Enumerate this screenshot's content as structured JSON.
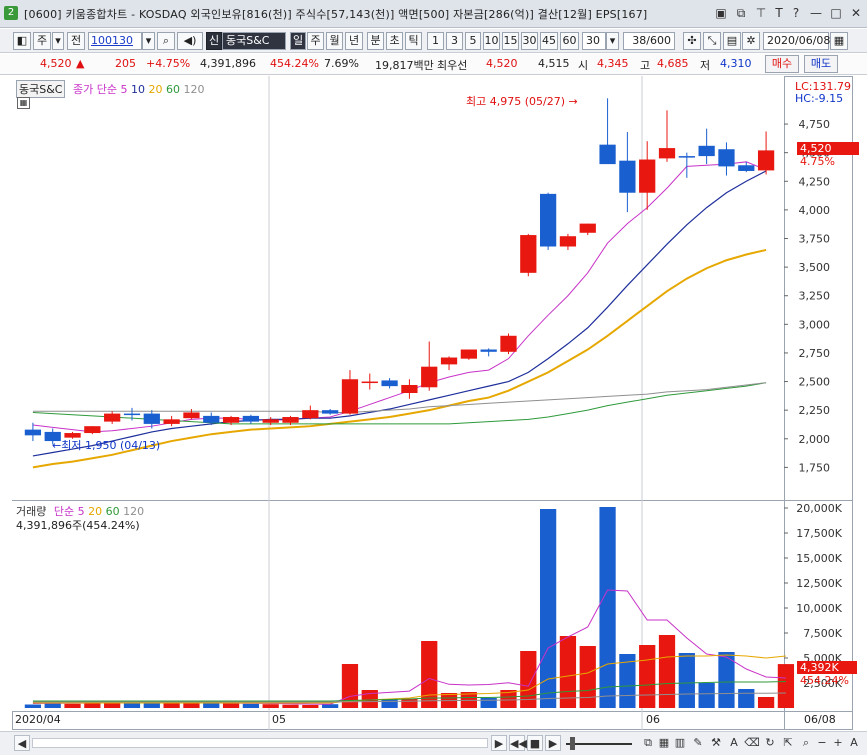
{
  "window": {
    "title": "[0600] 키움종합차트 - KOSDAQ 외국인보유[816(천)] 주식수[57,143(천)] 액면[500] 자본금[286(억)] 결산[12월] EPS[167]",
    "screen_number": "2"
  },
  "toolbar": {
    "mode_label": "주",
    "prev_label": "전",
    "stock_code": "100130",
    "stock_badge": "신",
    "stock_name": "동국S&C",
    "periods": [
      "일",
      "주",
      "월",
      "년",
      "분",
      "초",
      "틱"
    ],
    "intervals": [
      "1",
      "3",
      "5",
      "10",
      "15",
      "30",
      "45",
      "60"
    ],
    "interval_value": "30",
    "count_value": "38/600",
    "date_value": "2020/06/08"
  },
  "quote": {
    "price": "4,520",
    "arrow": "▲",
    "change": "205",
    "change_pct": "+4.75%",
    "volume": "4,391,896",
    "volume_ratio": "454.24%",
    "turnover": "7.69%",
    "amount": "19,817백만",
    "priority_label": "최우선",
    "ask1": "4,520",
    "bid1": "4,515",
    "open_label": "시",
    "open": "4,345",
    "high_label": "고",
    "high": "4,685",
    "low_label": "저",
    "low": "4,310",
    "buy_label": "매수",
    "sell_label": "매도"
  },
  "price_legend": {
    "name": "동국S&C",
    "ma_label": "종가 단순",
    "ma_periods": [
      "5",
      "10",
      "20",
      "60",
      "120"
    ]
  },
  "volume_legend": {
    "name": "거래량",
    "ma_label": "단순",
    "ma_periods": [
      "5",
      "20",
      "60",
      "120"
    ],
    "current": "4,391,896주(454.24%)"
  },
  "side_labels": {
    "lc": "LC:131.79",
    "hc": "HC:-9.15",
    "price_tag": "4,520",
    "pct_tag": "4.75%",
    "vol_tag": "4,392K",
    "vol_pct_tag": "454.24%"
  },
  "annotations": {
    "high_text": "최고 4,975 (05/27)",
    "low_text": "최저 1,950 (04/13)"
  },
  "x_labels": [
    "2020/04",
    "05",
    "06",
    "06/08"
  ],
  "colors": {
    "up": "#e8170f",
    "down": "#1a5fd0",
    "ma5": "#c832c8",
    "ma10": "#1e2f9c",
    "ma20": "#e6a800",
    "ma60": "#2e9a3a",
    "ma120": "#8f8f8f"
  },
  "chart_data": [
    {
      "type": "candlestick",
      "title": "동국S&C",
      "ylim": [
        1500,
        5100
      ],
      "yticks": [
        "1,750",
        "2,000",
        "2,250",
        "2,500",
        "2,750",
        "3,000",
        "3,250",
        "3,500",
        "3,750",
        "4,000",
        "4,250",
        "4,500",
        "4,750"
      ],
      "candles": [
        {
          "o": 2080,
          "h": 2140,
          "l": 1980,
          "c": 2030
        },
        {
          "o": 2060,
          "h": 2090,
          "l": 1950,
          "c": 1980
        },
        {
          "o": 2010,
          "h": 2060,
          "l": 2000,
          "c": 2050
        },
        {
          "o": 2050,
          "h": 2110,
          "l": 2040,
          "c": 2110
        },
        {
          "o": 2150,
          "h": 2240,
          "l": 2130,
          "c": 2220
        },
        {
          "o": 2220,
          "h": 2270,
          "l": 2160,
          "c": 2210
        },
        {
          "o": 2220,
          "h": 2250,
          "l": 2090,
          "c": 2130
        },
        {
          "o": 2130,
          "h": 2200,
          "l": 2110,
          "c": 2170
        },
        {
          "o": 2180,
          "h": 2260,
          "l": 2170,
          "c": 2230
        },
        {
          "o": 2200,
          "h": 2230,
          "l": 2120,
          "c": 2140
        },
        {
          "o": 2140,
          "h": 2200,
          "l": 2120,
          "c": 2190
        },
        {
          "o": 2200,
          "h": 2210,
          "l": 2130,
          "c": 2150
        },
        {
          "o": 2140,
          "h": 2190,
          "l": 2120,
          "c": 2170
        },
        {
          "o": 2140,
          "h": 2200,
          "l": 2120,
          "c": 2190
        },
        {
          "o": 2180,
          "h": 2290,
          "l": 2170,
          "c": 2250
        },
        {
          "o": 2250,
          "h": 2260,
          "l": 2210,
          "c": 2220
        },
        {
          "o": 2220,
          "h": 2600,
          "l": 2210,
          "c": 2520
        },
        {
          "o": 2500,
          "h": 2570,
          "l": 2430,
          "c": 2500
        },
        {
          "o": 2510,
          "h": 2530,
          "l": 2440,
          "c": 2460
        },
        {
          "o": 2400,
          "h": 2520,
          "l": 2350,
          "c": 2470
        },
        {
          "o": 2450,
          "h": 2850,
          "l": 2420,
          "c": 2630
        },
        {
          "o": 2650,
          "h": 2720,
          "l": 2600,
          "c": 2710
        },
        {
          "o": 2700,
          "h": 2780,
          "l": 2690,
          "c": 2780
        },
        {
          "o": 2780,
          "h": 2790,
          "l": 2720,
          "c": 2760
        },
        {
          "o": 2760,
          "h": 2920,
          "l": 2740,
          "c": 2900
        },
        {
          "o": 3450,
          "h": 3790,
          "l": 3420,
          "c": 3780
        },
        {
          "o": 4140,
          "h": 4150,
          "l": 3650,
          "c": 3680
        },
        {
          "o": 3680,
          "h": 3790,
          "l": 3650,
          "c": 3770
        },
        {
          "o": 3800,
          "h": 3880,
          "l": 3780,
          "c": 3880
        },
        {
          "o": 4570,
          "h": 4975,
          "l": 4420,
          "c": 4400
        },
        {
          "o": 4430,
          "h": 4680,
          "l": 3980,
          "c": 4150
        },
        {
          "o": 4150,
          "h": 4600,
          "l": 4000,
          "c": 4440
        },
        {
          "o": 4450,
          "h": 4870,
          "l": 4420,
          "c": 4540
        },
        {
          "o": 4470,
          "h": 4500,
          "l": 4280,
          "c": 4460
        },
        {
          "o": 4560,
          "h": 4710,
          "l": 4400,
          "c": 4470
        },
        {
          "o": 4530,
          "h": 4590,
          "l": 4300,
          "c": 4380
        },
        {
          "o": 4390,
          "h": 4420,
          "l": 4330,
          "c": 4340
        },
        {
          "o": 4345,
          "h": 4685,
          "l": 4310,
          "c": 4520
        }
      ],
      "ma": [
        {
          "name": "5",
          "values": [
            2120,
            2100,
            2080,
            2060,
            2070,
            2090,
            2110,
            2140,
            2170,
            2180,
            2180,
            2170,
            2160,
            2170,
            2180,
            2190,
            2240,
            2300,
            2360,
            2420,
            2490,
            2540,
            2580,
            2600,
            2700,
            2900,
            3080,
            3250,
            3450,
            3710,
            3880,
            4020,
            4190,
            4380,
            4390,
            4400,
            4420,
            4350
          ]
        },
        {
          "name": "10",
          "values": [
            1850,
            1880,
            1910,
            1940,
            1980,
            2020,
            2060,
            2090,
            2110,
            2130,
            2150,
            2160,
            2170,
            2170,
            2180,
            2180,
            2200,
            2230,
            2260,
            2300,
            2340,
            2380,
            2420,
            2460,
            2500,
            2580,
            2700,
            2830,
            2970,
            3150,
            3340,
            3520,
            3700,
            3870,
            4020,
            4150,
            4250,
            4340
          ]
        },
        {
          "name": "20",
          "values": [
            1750,
            1780,
            1800,
            1830,
            1860,
            1900,
            1940,
            1980,
            2010,
            2040,
            2060,
            2080,
            2090,
            2100,
            2110,
            2130,
            2150,
            2170,
            2190,
            2220,
            2250,
            2290,
            2330,
            2360,
            2420,
            2500,
            2580,
            2680,
            2780,
            2900,
            3030,
            3160,
            3290,
            3400,
            3490,
            3560,
            3610,
            3650
          ]
        },
        {
          "name": "60",
          "values": [
            2230,
            2220,
            2210,
            2200,
            2190,
            2180,
            2170,
            2160,
            2150,
            2140,
            2130,
            2130,
            2130,
            2130,
            2130,
            2130,
            2130,
            2130,
            2130,
            2130,
            2130,
            2130,
            2140,
            2150,
            2160,
            2170,
            2190,
            2220,
            2250,
            2290,
            2320,
            2350,
            2380,
            2400,
            2420,
            2440,
            2460,
            2490
          ]
        },
        {
          "name": "120",
          "values": [
            2240,
            2240,
            2240,
            2240,
            2240,
            2240,
            2240,
            2240,
            2240,
            2240,
            2240,
            2240,
            2240,
            2240,
            2240,
            2230,
            2230,
            2240,
            2250,
            2260,
            2280,
            2290,
            2300,
            2310,
            2320,
            2330,
            2340,
            2350,
            2360,
            2370,
            2380,
            2390,
            2410,
            2420,
            2430,
            2450,
            2470,
            2490
          ]
        }
      ]
    },
    {
      "type": "bar",
      "title": "거래량",
      "unit": "K",
      "ylim": [
        0,
        21000
      ],
      "yticks": [
        "2,500K",
        "5,000K",
        "7,500K",
        "10,000K",
        "12,500K",
        "15,000K",
        "17,500K",
        "20,000K"
      ],
      "values": [
        350,
        500,
        420,
        600,
        700,
        500,
        450,
        520,
        480,
        500,
        460,
        420,
        380,
        330,
        300,
        380,
        4400,
        1800,
        900,
        950,
        6700,
        1500,
        1600,
        1000,
        1800,
        5700,
        19900,
        7200,
        6200,
        20100,
        5400,
        6300,
        7300,
        5500,
        2500,
        5600,
        1900,
        1100,
        4392
      ],
      "ma": [
        {
          "name": "5",
          "values": [
            450,
            470,
            480,
            500,
            530,
            550,
            560,
            520,
            510,
            500,
            490,
            480,
            450,
            420,
            390,
            380,
            1160,
            1450,
            1560,
            1690,
            2950,
            2370,
            2300,
            2350,
            2520,
            2180,
            6000,
            7100,
            8100,
            11800,
            11700,
            8800,
            8800,
            7000,
            5400,
            5100,
            3900,
            3100,
            3000
          ]
        },
        {
          "name": "20",
          "values": [
            500,
            500,
            500,
            500,
            500,
            500,
            500,
            500,
            500,
            500,
            500,
            500,
            500,
            500,
            500,
            500,
            700,
            800,
            900,
            1000,
            1300,
            1350,
            1400,
            1450,
            1550,
            1800,
            2900,
            3200,
            3500,
            4400,
            4600,
            4800,
            5100,
            5200,
            5200,
            5300,
            5200,
            5000,
            5200
          ]
        },
        {
          "name": "60",
          "values": [
            700,
            700,
            700,
            700,
            700,
            700,
            700,
            700,
            700,
            700,
            700,
            700,
            700,
            700,
            700,
            700,
            750,
            800,
            850,
            900,
            1000,
            1000,
            1050,
            1050,
            1100,
            1200,
            1500,
            1650,
            1750,
            2100,
            2200,
            2300,
            2450,
            2500,
            2550,
            2600,
            2600,
            2600,
            2650
          ]
        },
        {
          "name": "120",
          "values": [
            600,
            600,
            600,
            600,
            600,
            600,
            600,
            600,
            600,
            600,
            600,
            600,
            600,
            600,
            600,
            600,
            620,
            640,
            660,
            680,
            720,
            740,
            760,
            780,
            800,
            850,
            950,
            1000,
            1050,
            1200,
            1250,
            1300,
            1350,
            1400,
            1420,
            1450,
            1470,
            1480,
            1500
          ]
        }
      ]
    }
  ]
}
